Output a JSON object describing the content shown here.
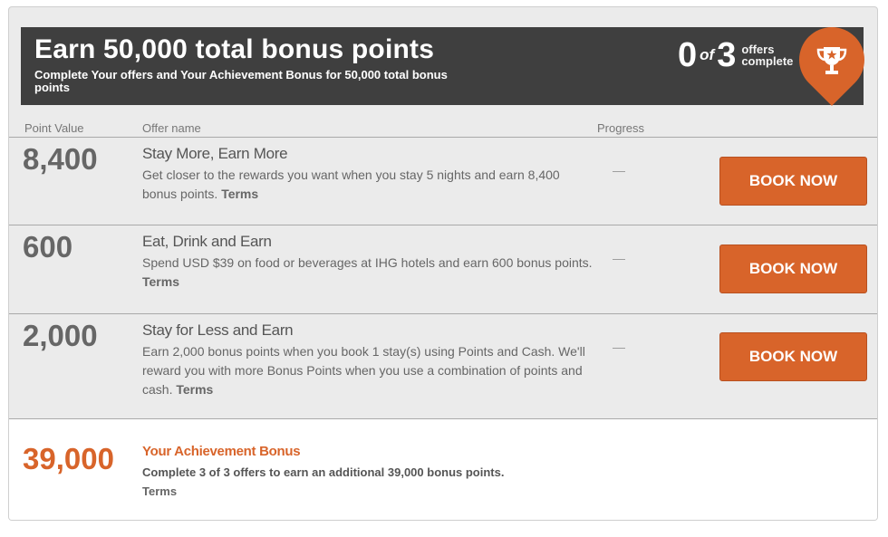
{
  "header": {
    "title": "Earn 50,000 total bonus points",
    "subtitle": "Complete Your offers and Your Achievement Bonus for 50,000 total bonus points",
    "completed": "0",
    "of": "of",
    "total": "3",
    "counter_label": "offers complete",
    "badge_icon": "trophy-icon",
    "accent": "#d8642a"
  },
  "columns": {
    "point_value": "Point Value",
    "offer_name": "Offer name",
    "progress": "Progress"
  },
  "offers": [
    {
      "points": "8,400",
      "name": "Stay More, Earn More",
      "description": "Get closer to the rewards you want when you stay 5 nights and earn 8,400 bonus points.",
      "terms": "Terms",
      "progress": "—",
      "button": "BOOK NOW"
    },
    {
      "points": "600",
      "name": "Eat, Drink and Earn",
      "description": "Spend USD $39 on food or beverages at IHG hotels and earn 600 bonus points.",
      "terms": "Terms",
      "progress": "—",
      "button": "BOOK NOW"
    },
    {
      "points": "2,000",
      "name": "Stay for Less and Earn",
      "description": "Earn 2,000 bonus points when you book 1 stay(s) using Points and Cash. We'll reward you with more Bonus Points when you use a combination of points and cash.",
      "terms": "Terms",
      "progress": "—",
      "button": "BOOK NOW"
    }
  ],
  "achievement": {
    "points": "39,000",
    "name": "Your Achievement Bonus",
    "description": "Complete 3 of 3 offers to earn an additional 39,000 bonus points.",
    "terms": "Terms"
  }
}
